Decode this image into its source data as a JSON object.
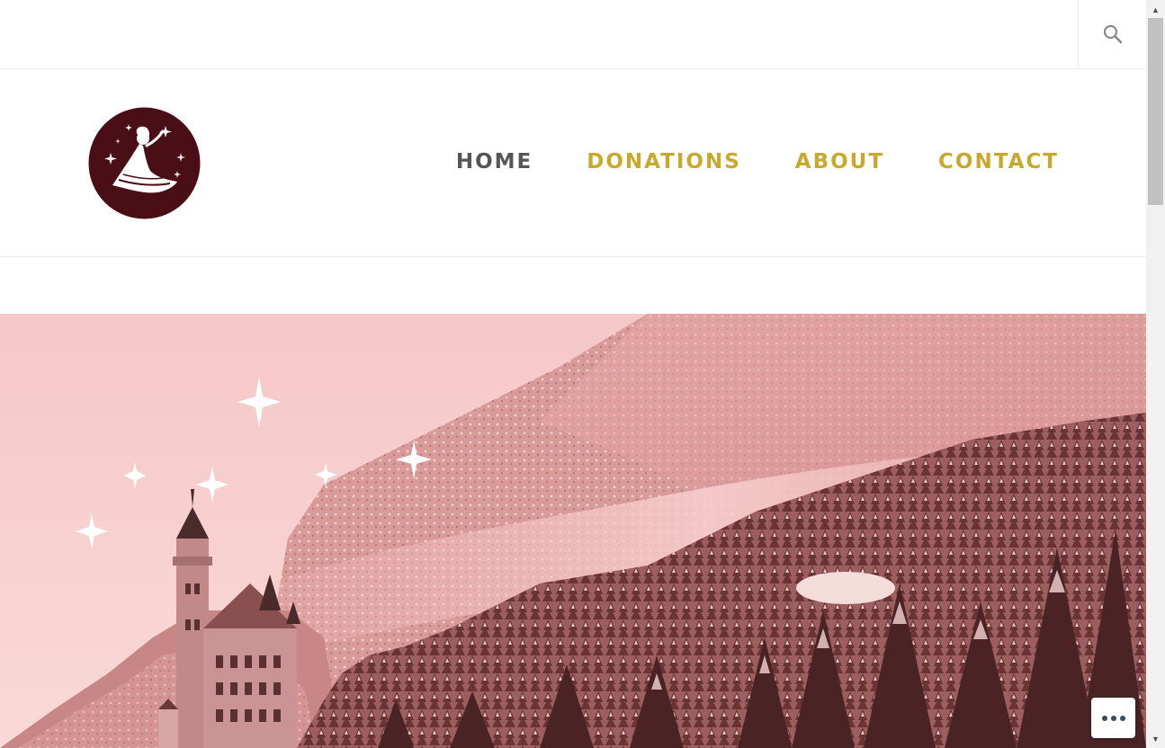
{
  "topbar": {
    "search_icon": "search-icon"
  },
  "header": {
    "logo": {
      "icon": "fairy-godmother-logo",
      "colors": {
        "circle": "#4a0e16",
        "figure": "#ffffff"
      }
    },
    "nav": {
      "items": [
        {
          "label": "HOME",
          "color": "#555555"
        },
        {
          "label": "DONATIONS",
          "color": "#c9a92c"
        },
        {
          "label": "ABOUT",
          "color": "#c9a92c"
        },
        {
          "label": "CONTACT",
          "color": "#c9a92c"
        }
      ]
    }
  },
  "hero": {
    "image": "pink-tinted-snowy-castle-forest",
    "colors": {
      "sky": "#f7cfcf",
      "mountain": "#e8a5a5",
      "trees": "#5a2c2c"
    }
  },
  "floating": {
    "more_icon": "ellipsis-icon"
  }
}
